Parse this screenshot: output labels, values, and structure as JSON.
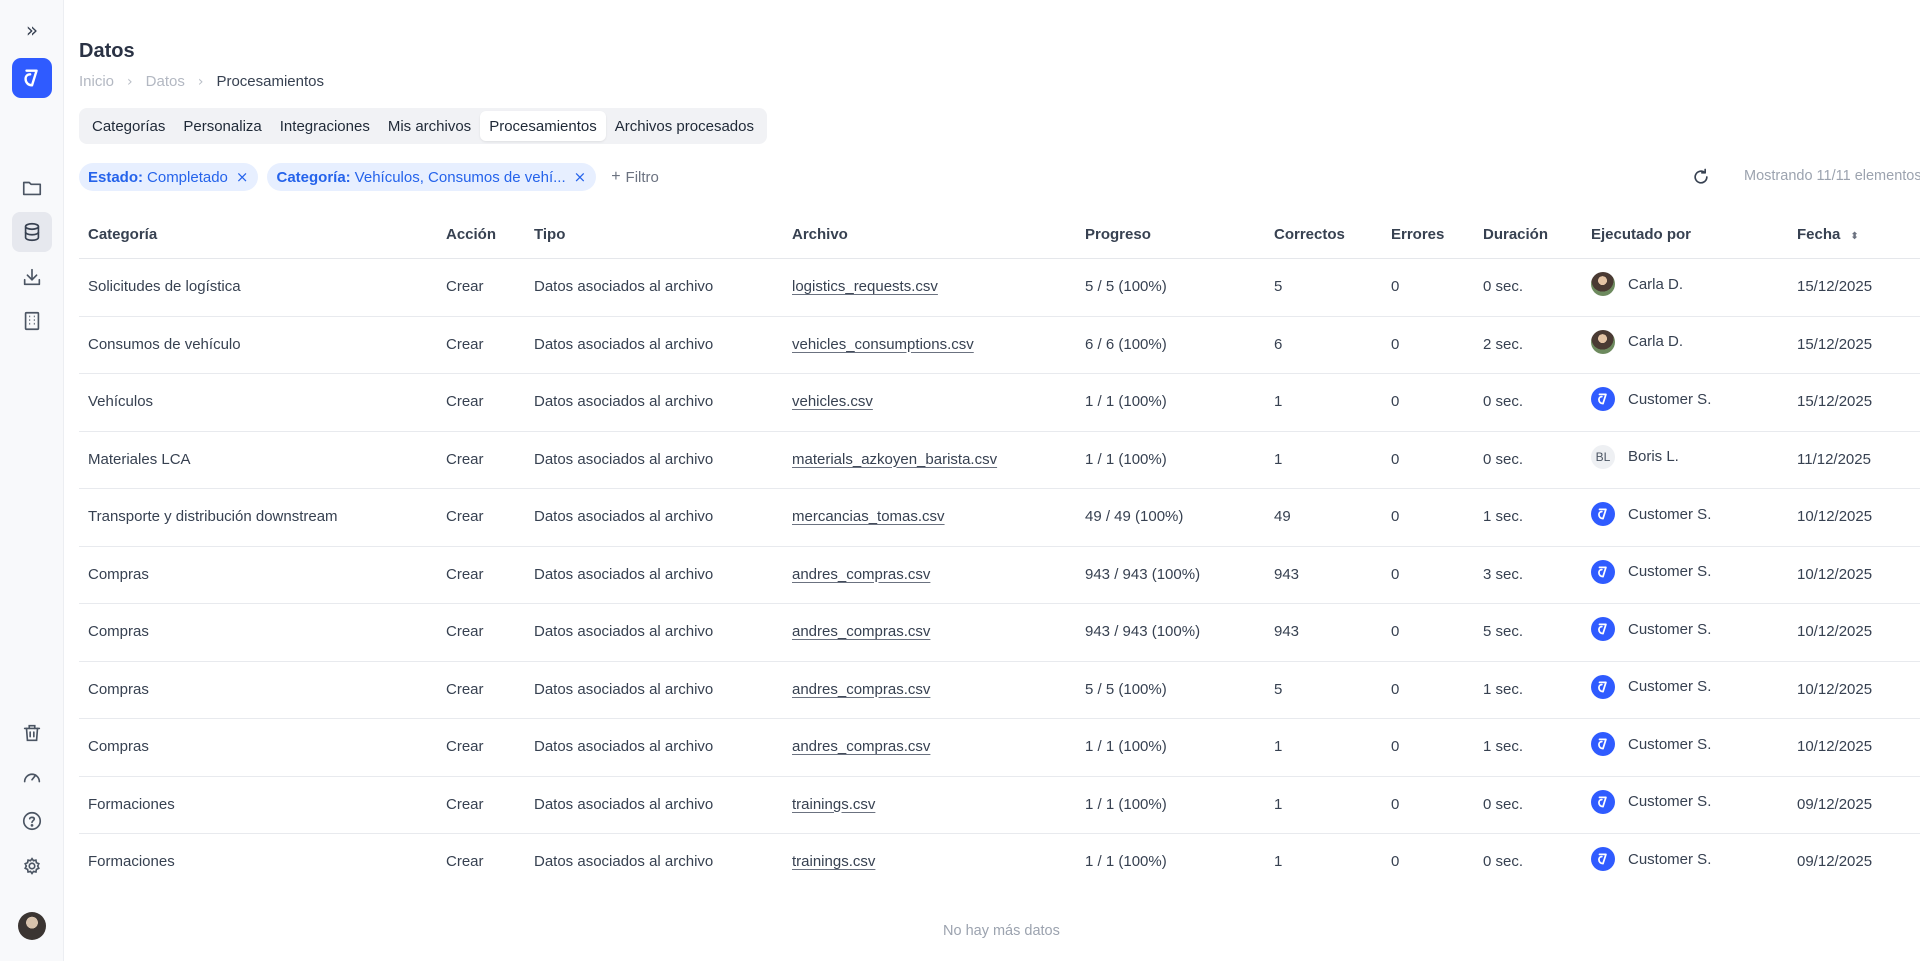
{
  "page": {
    "title": "Datos"
  },
  "breadcrumb": {
    "items": [
      "Inicio",
      "Datos",
      "Procesamientos"
    ]
  },
  "tabs": [
    "Categorías",
    "Personaliza",
    "Integraciones",
    "Mis archivos",
    "Procesamientos",
    "Archivos procesados"
  ],
  "active_tab": "Procesamientos",
  "filters": [
    {
      "key": "Estado:",
      "value": "Completado"
    },
    {
      "key": "Categoría:",
      "value": "Vehículos, Consumos de vehí..."
    }
  ],
  "add_filter_label": "Filtro",
  "count_text": "Mostrando 11/11 elementos",
  "table": {
    "headers": [
      "Categoría",
      "Acción",
      "Tipo",
      "Archivo",
      "Progreso",
      "Correctos",
      "Errores",
      "Duración",
      "Ejecutado por",
      "Fecha"
    ],
    "rows": [
      {
        "categoria": "Solicitudes de logística",
        "accion": "Crear",
        "tipo": "Datos asociados al archivo",
        "archivo": "logistics_requests.csv",
        "progreso": "5 / 5 (100%)",
        "correctos": "5",
        "errores": "0",
        "duracion": "0 sec.",
        "ejecutado": "Carla D.",
        "avatar": "photo",
        "fecha": "15/12/2025"
      },
      {
        "categoria": "Consumos de vehículo",
        "accion": "Crear",
        "tipo": "Datos asociados al archivo",
        "archivo": "vehicles_consumptions.csv",
        "progreso": "6 / 6 (100%)",
        "correctos": "6",
        "errores": "0",
        "duracion": "2 sec.",
        "ejecutado": "Carla D.",
        "avatar": "photo",
        "fecha": "15/12/2025"
      },
      {
        "categoria": "Vehículos",
        "accion": "Crear",
        "tipo": "Datos asociados al archivo",
        "archivo": "vehicles.csv",
        "progreso": "1 / 1 (100%)",
        "correctos": "1",
        "errores": "0",
        "duracion": "0 sec.",
        "ejecutado": "Customer S.",
        "avatar": "brand",
        "fecha": "15/12/2025"
      },
      {
        "categoria": "Materiales LCA",
        "accion": "Crear",
        "tipo": "Datos asociados al archivo",
        "archivo": "materials_azkoyen_barista.csv",
        "progreso": "1 / 1 (100%)",
        "correctos": "1",
        "errores": "0",
        "duracion": "0 sec.",
        "ejecutado": "Boris L.",
        "avatar": "BL",
        "fecha": "11/12/2025"
      },
      {
        "categoria": "Transporte y distribución downstream",
        "accion": "Crear",
        "tipo": "Datos asociados al archivo",
        "archivo": "mercancias_tomas.csv",
        "progreso": "49 / 49 (100%)",
        "correctos": "49",
        "errores": "0",
        "duracion": "1 sec.",
        "ejecutado": "Customer S.",
        "avatar": "brand",
        "fecha": "10/12/2025"
      },
      {
        "categoria": "Compras",
        "accion": "Crear",
        "tipo": "Datos asociados al archivo",
        "archivo": "andres_compras.csv",
        "progreso": "943 / 943 (100%)",
        "correctos": "943",
        "errores": "0",
        "duracion": "3 sec.",
        "ejecutado": "Customer S.",
        "avatar": "brand",
        "fecha": "10/12/2025"
      },
      {
        "categoria": "Compras",
        "accion": "Crear",
        "tipo": "Datos asociados al archivo",
        "archivo": "andres_compras.csv",
        "progreso": "943 / 943 (100%)",
        "correctos": "943",
        "errores": "0",
        "duracion": "5 sec.",
        "ejecutado": "Customer S.",
        "avatar": "brand",
        "fecha": "10/12/2025"
      },
      {
        "categoria": "Compras",
        "accion": "Crear",
        "tipo": "Datos asociados al archivo",
        "archivo": "andres_compras.csv",
        "progreso": "5 / 5 (100%)",
        "correctos": "5",
        "errores": "0",
        "duracion": "1 sec.",
        "ejecutado": "Customer S.",
        "avatar": "brand",
        "fecha": "10/12/2025"
      },
      {
        "categoria": "Compras",
        "accion": "Crear",
        "tipo": "Datos asociados al archivo",
        "archivo": "andres_compras.csv",
        "progreso": "1 / 1 (100%)",
        "correctos": "1",
        "errores": "0",
        "duracion": "1 sec.",
        "ejecutado": "Customer S.",
        "avatar": "brand",
        "fecha": "10/12/2025"
      },
      {
        "categoria": "Formaciones",
        "accion": "Crear",
        "tipo": "Datos asociados al archivo",
        "archivo": "trainings.csv",
        "progreso": "1 / 1 (100%)",
        "correctos": "1",
        "errores": "0",
        "duracion": "0 sec.",
        "ejecutado": "Customer S.",
        "avatar": "brand",
        "fecha": "09/12/2025"
      },
      {
        "categoria": "Formaciones",
        "accion": "Crear",
        "tipo": "Datos asociados al archivo",
        "archivo": "trainings.csv",
        "progreso": "1 / 1 (100%)",
        "correctos": "1",
        "errores": "0",
        "duracion": "0 sec.",
        "ejecutado": "Customer S.",
        "avatar": "brand",
        "fecha": "09/12/2025"
      }
    ]
  },
  "footer_text": "No hay más datos",
  "sidebar": {
    "icons": [
      "expand-icon",
      "app-logo",
      "folder-icon",
      "database-icon",
      "download-icon",
      "building-icon",
      "trash-icon",
      "gauge-icon",
      "help-icon",
      "gear-icon",
      "user-avatar"
    ]
  },
  "colors": {
    "accent": "#2f5bff",
    "chip_bg": "#e7efff",
    "chip_text": "#2563eb"
  }
}
